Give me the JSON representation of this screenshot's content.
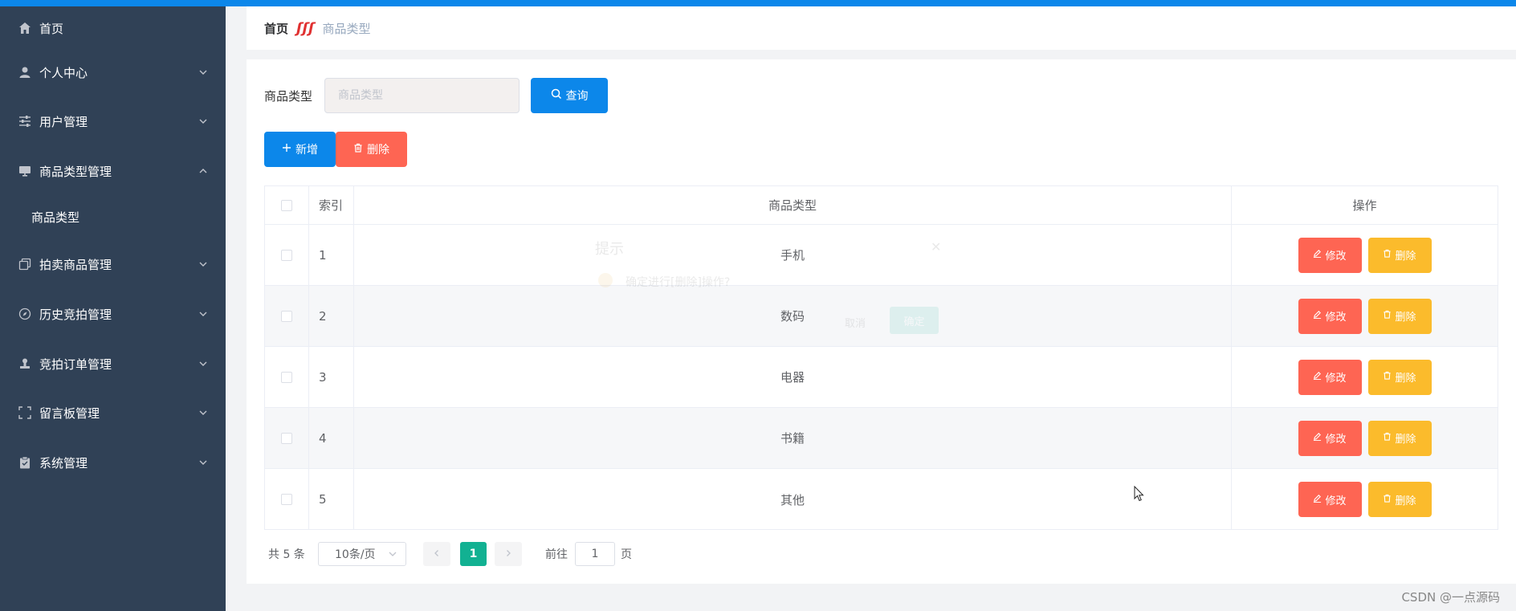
{
  "sidebar": {
    "items": [
      {
        "label": "首页",
        "icon": "home-icon"
      },
      {
        "label": "个人中心",
        "icon": "user-icon"
      },
      {
        "label": "用户管理",
        "icon": "sliders-icon"
      },
      {
        "label": "商品类型管理",
        "icon": "monitor-icon"
      },
      {
        "label": "商品类型",
        "icon": ""
      },
      {
        "label": "拍卖商品管理",
        "icon": "copy-icon"
      },
      {
        "label": "历史竞拍管理",
        "icon": "compass-icon"
      },
      {
        "label": "竞拍订单管理",
        "icon": "stamp-icon"
      },
      {
        "label": "留言板管理",
        "icon": "fullscreen-icon"
      },
      {
        "label": "系统管理",
        "icon": "clipboard-icon"
      }
    ]
  },
  "breadcrumb": {
    "home": "首页",
    "separator": "ʃʃʃ",
    "current": "商品类型"
  },
  "search": {
    "label": "商品类型",
    "placeholder": "商品类型",
    "button": "查询"
  },
  "actions": {
    "add": "新增",
    "delete": "删除"
  },
  "table": {
    "headers": {
      "index": "索引",
      "type": "商品类型",
      "ops": "操作"
    },
    "rows": [
      {
        "index": "1",
        "type": "手机"
      },
      {
        "index": "2",
        "type": "数码"
      },
      {
        "index": "3",
        "type": "电器"
      },
      {
        "index": "4",
        "type": "书籍"
      },
      {
        "index": "5",
        "type": "其他"
      }
    ],
    "edit_label": "修改",
    "delete_label": "删除"
  },
  "pagination": {
    "total": "共 5 条",
    "page_size": "10条/页",
    "current_page": "1",
    "goto_prefix": "前往",
    "goto_value": "1",
    "goto_suffix": "页"
  },
  "faint_dialog": {
    "title": "提示",
    "message": "确定进行[删除]操作?",
    "cancel": "取消",
    "confirm": "确定"
  },
  "watermark": "CSDN @一点源码",
  "colors": {
    "topbar": "#0c87ea",
    "sidebar": "#304156",
    "primary": "#0c87ea",
    "danger": "#fe6553",
    "warning": "#fbbb2c",
    "pager_active": "#12b192"
  }
}
